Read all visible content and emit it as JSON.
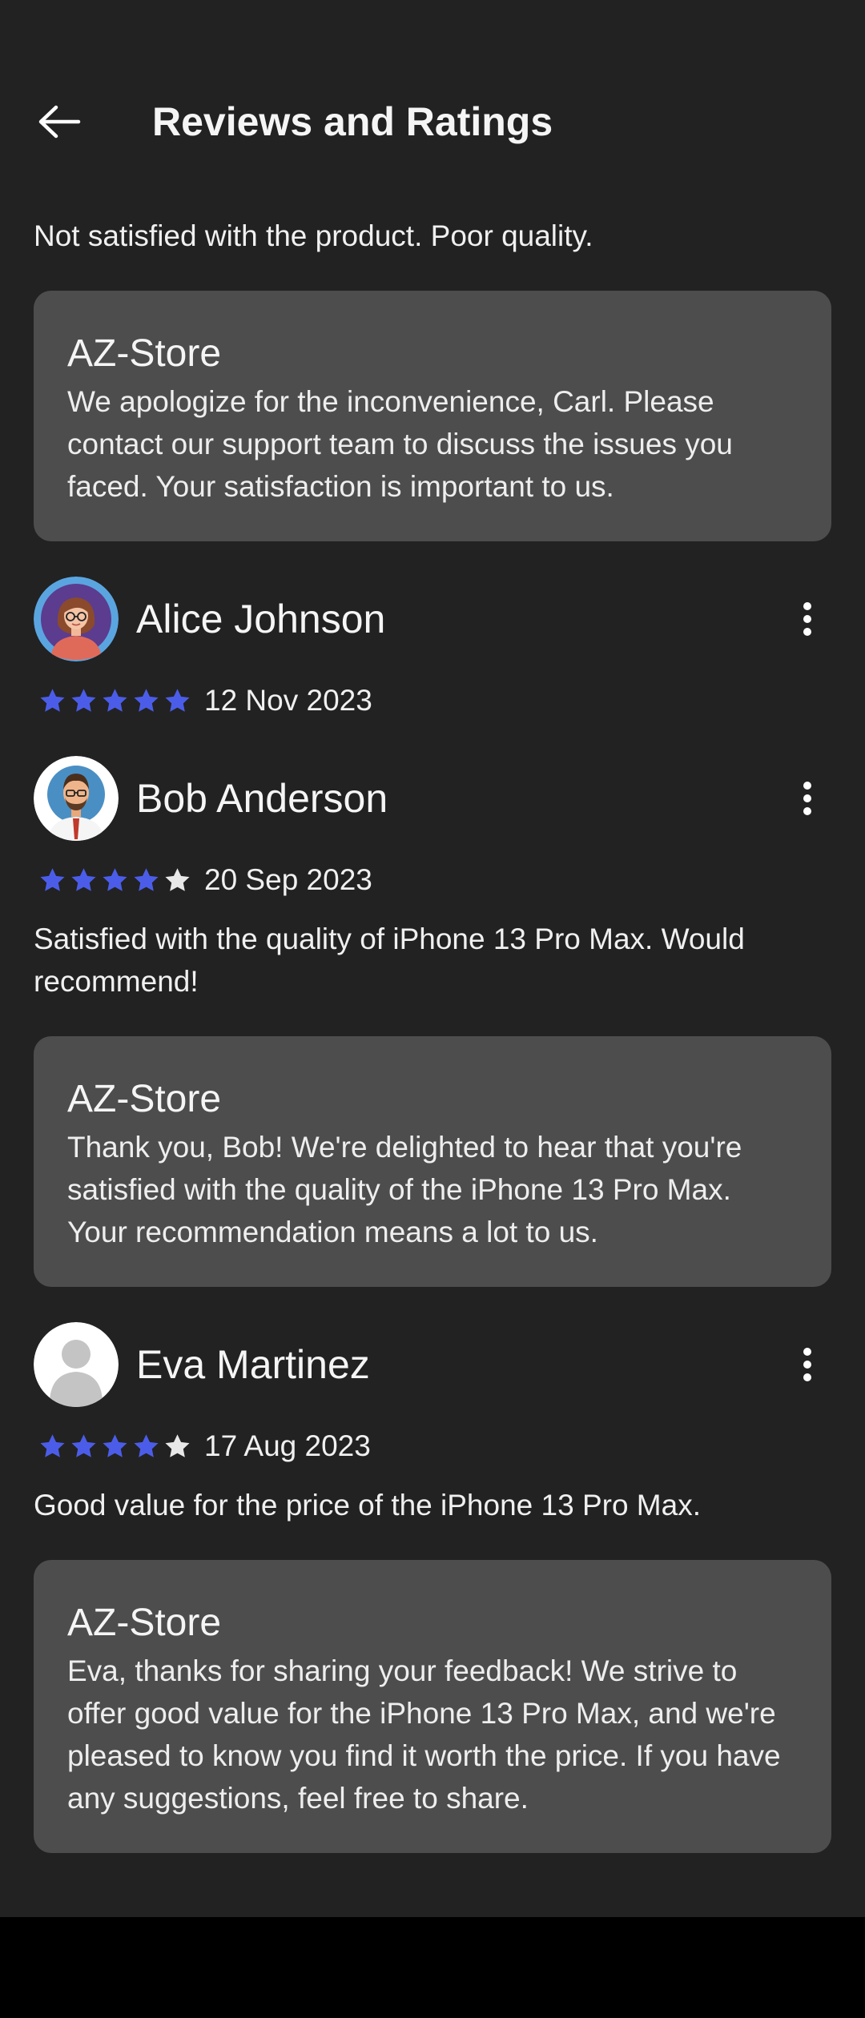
{
  "header": {
    "title": "Reviews and Ratings"
  },
  "top_review": {
    "text": "Not satisfied with the product. Poor quality.",
    "reply": {
      "author": "AZ-Store",
      "body": "We apologize for the inconvenience, Carl. Please contact our support team to discuss the issues you faced. Your satisfaction is important to us."
    }
  },
  "reviews": [
    {
      "name": "Alice Johnson",
      "rating": 5,
      "date": "12 Nov 2023",
      "avatar": "woman-avatar-icon"
    },
    {
      "name": "Bob Anderson",
      "rating": 4,
      "date": "20 Sep 2023",
      "avatar": "man-avatar-icon",
      "text": "Satisfied with the quality of iPhone 13 Pro Max. Would recommend!",
      "reply": {
        "author": "AZ-Store",
        "body": "Thank you, Bob! We're delighted to hear that you're satisfied with the quality of the iPhone 13 Pro Max. Your recommendation means a lot to us."
      }
    },
    {
      "name": "Eva Martinez",
      "rating": 4,
      "date": "17 Aug 2023",
      "avatar": "default-user-avatar-icon",
      "text": "Good value for the price of the iPhone 13 Pro Max.",
      "reply": {
        "author": "AZ-Store",
        "body": "Eva, thanks for sharing your feedback! We strive to offer good value for the iPhone 13 Pro Max, and we're pleased to know you find it worth the price. If you have any suggestions, feel free to share."
      }
    }
  ],
  "colors": {
    "background": "#222222",
    "card": "#4d4d4d",
    "star_filled": "#4b5de8",
    "star_empty": "#e8e8e8"
  }
}
